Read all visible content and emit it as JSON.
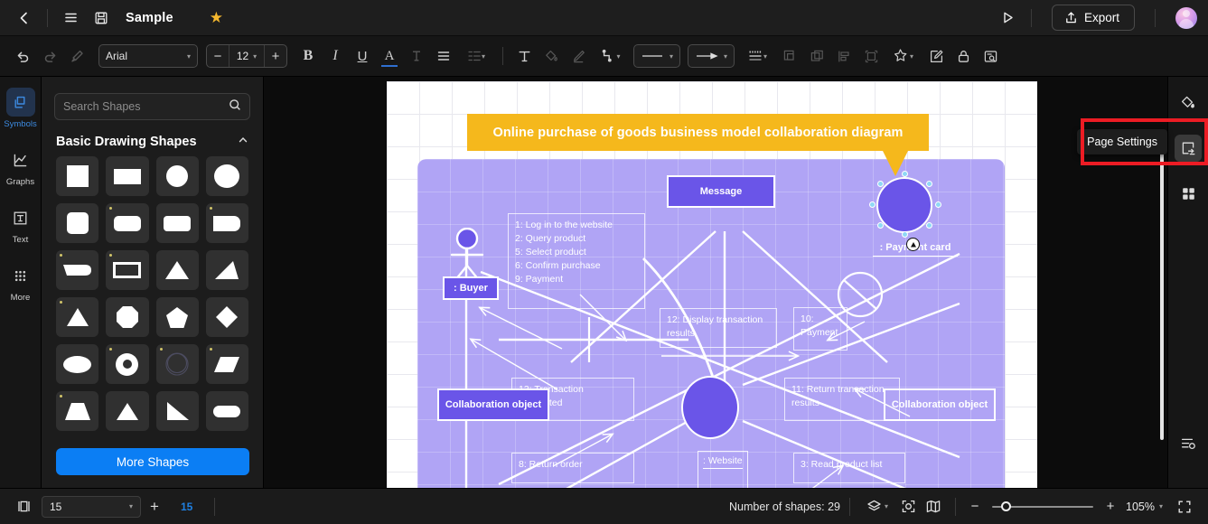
{
  "app": {
    "title": "Sample"
  },
  "topbar": {
    "back_icon": "back-arrow-icon",
    "menu_icon": "hamburger-menu-icon",
    "save_icon": "save-disk-icon",
    "favorite_icon": "star-icon",
    "present_icon": "play-present-icon",
    "export_label": "Export",
    "avatar": "user-avatar"
  },
  "toolbar": {
    "undo": "undo-icon",
    "redo": "redo-icon",
    "format_painter": "format-painter-icon",
    "font_family": "Arial",
    "font_size": "12",
    "decrease_label": "−",
    "increase_label": "+",
    "bold": "B",
    "italic": "I",
    "underline": "U",
    "font_color": "A",
    "strikethrough": "text-strikethrough-icon",
    "align": "align-icon",
    "line_spacing": "line-spacing-icon",
    "text_tool": "text-tool-icon",
    "fill_color": "fill-bucket-icon",
    "pen_color": "pen-icon",
    "connector": "connector-line-icon",
    "line_style": "line-style-icon",
    "arrow_style": "arrow-style-icon",
    "line_weight": "line-weight-icon",
    "bring_front": "bring-to-front-icon",
    "send_back": "send-to-back-icon",
    "align_objects": "align-objects-icon",
    "group": "group-icon",
    "effects": "effects-star-icon",
    "edit": "edit-pencil-icon",
    "lock": "lock-icon",
    "find": "find-replace-icon"
  },
  "left_rail": {
    "items": [
      {
        "label": "Symbols",
        "icon": "symbols-icon",
        "active": true
      },
      {
        "label": "Graphs",
        "icon": "graphs-chart-icon",
        "active": false
      },
      {
        "label": "Text",
        "icon": "text-box-icon",
        "active": false
      },
      {
        "label": "More",
        "icon": "more-grid-icon",
        "active": false
      }
    ]
  },
  "shapes_panel": {
    "search_placeholder": "Search Shapes",
    "search_value": "",
    "search_icon": "search-icon",
    "section_title": "Basic Drawing Shapes",
    "collapse_icon": "chevron-up-icon",
    "more_shapes_label": "More Shapes",
    "shapes": [
      {
        "name": "square",
        "dot": false
      },
      {
        "name": "rectangle",
        "dot": false
      },
      {
        "name": "circle",
        "dot": false
      },
      {
        "name": "ellipse-round",
        "dot": false
      },
      {
        "name": "rounded-square",
        "dot": false
      },
      {
        "name": "rounded-rectangle",
        "dot": true
      },
      {
        "name": "rounded-rectangle-2",
        "dot": false
      },
      {
        "name": "rounded-corner-rectangle",
        "dot": true
      },
      {
        "name": "cut-corner-rectangle",
        "dot": true
      },
      {
        "name": "frame-rectangle",
        "dot": true
      },
      {
        "name": "triangle",
        "dot": false
      },
      {
        "name": "right-triangle-slant",
        "dot": false
      },
      {
        "name": "triangle-wide",
        "dot": true
      },
      {
        "name": "octagon",
        "dot": false
      },
      {
        "name": "pentagon",
        "dot": false
      },
      {
        "name": "diamond",
        "dot": false
      },
      {
        "name": "oval",
        "dot": false
      },
      {
        "name": "donut",
        "dot": true
      },
      {
        "name": "double-circle-outline",
        "dot": true
      },
      {
        "name": "parallelogram",
        "dot": true
      },
      {
        "name": "trapezoid",
        "dot": true
      },
      {
        "name": "triangle-isosceles",
        "dot": false
      },
      {
        "name": "right-triangle",
        "dot": false
      },
      {
        "name": "pill-capsule",
        "dot": false
      }
    ]
  },
  "canvas": {
    "diagram_title": "Online purchase of goods business model collaboration diagram",
    "nodes": [
      {
        "id": "message",
        "label": "Message",
        "type": "filled-note"
      },
      {
        "id": "collab-left",
        "label": "Collaboration object",
        "type": "filled-note"
      },
      {
        "id": "collab-right",
        "label": "Collaboration object",
        "type": "outline-note"
      }
    ],
    "actors": [
      {
        "id": "buyer",
        "label": ": Buyer",
        "type": "actor-stick-figure"
      },
      {
        "id": "website",
        "label": ": Website",
        "type": "object-box"
      },
      {
        "id": "payment-card",
        "label": ": Payment card",
        "type": "selected-circle"
      }
    ],
    "messages": [
      "1: Log in to the website",
      "2: Query product",
      "5: Select product",
      "6: Confirm purchase",
      "9: Payment",
      "12: Display transaction results",
      "10: Payment",
      "13: Transaction completed",
      "11: Return transaction results",
      "8: Return order",
      "3: Read product list"
    ],
    "note_left": "1: Log in to the website\n2: Query product\n5: Select product\n6: Confirm purchase\n9: Payment",
    "note_12": "12: Display transaction results",
    "note_10": "10: Payment",
    "note_13": "13: Transaction completed",
    "note_11": "11: Return transaction results",
    "note_8": "8: Return order",
    "note_3": "3: Read product list"
  },
  "right_rail": {
    "fill_icon": "paint-bucket-icon",
    "page_settings_icon": "page-settings-icon",
    "apps_icon": "apps-grid-icon",
    "list_settings_icon": "list-settings-icon",
    "tooltip": "Page Settings",
    "highlight_color": "#ec1c24"
  },
  "status_bar": {
    "pages_icon": "pages-panel-icon",
    "page_value": "15",
    "add_page_label": "+",
    "current_page": "15",
    "shape_count_label": "Number of shapes: 29",
    "layers_icon": "layers-icon",
    "focus_icon": "focus-icon",
    "map_icon": "map-overview-icon",
    "zoom_out_label": "−",
    "zoom_in_label": "+",
    "zoom_level": "105%",
    "fullscreen_icon": "fullscreen-icon"
  }
}
